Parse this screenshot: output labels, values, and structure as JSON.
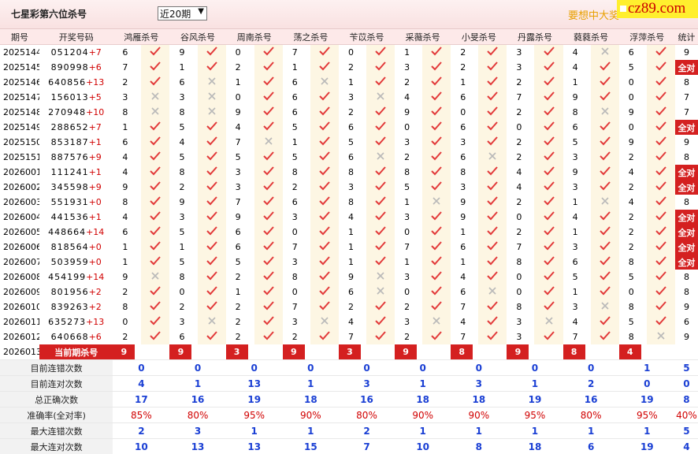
{
  "header": {
    "title": "七星彩第六位杀号",
    "select_value": "近20期",
    "promo": "要想中大奖",
    "logo": "cz89.com"
  },
  "columns": [
    "期号",
    "开奖号码",
    "鸿雁杀号",
    "谷风杀号",
    "周南杀号",
    "荡之杀号",
    "苄苡杀号",
    "采薇杀号",
    "小旻杀号",
    "丹露杀号",
    "蕤蕤杀号",
    "浮萍杀号",
    "统计"
  ],
  "rows": [
    {
      "issue": "2025144",
      "num": "051204",
      "last": "+7",
      "vals": [
        6,
        9,
        0,
        7,
        0,
        1,
        2,
        3,
        4,
        6
      ],
      "ok": [
        1,
        1,
        1,
        1,
        1,
        1,
        1,
        1,
        0,
        1
      ],
      "stat": "9"
    },
    {
      "issue": "2025145",
      "num": "890998",
      "last": "+6",
      "vals": [
        7,
        1,
        2,
        1,
        2,
        3,
        2,
        3,
        4,
        5
      ],
      "ok": [
        1,
        1,
        1,
        1,
        1,
        1,
        1,
        1,
        1,
        1
      ],
      "stat": "全对"
    },
    {
      "issue": "2025146",
      "num": "640856",
      "last": "+13",
      "vals": [
        2,
        6,
        1,
        6,
        1,
        2,
        1,
        2,
        1,
        0
      ],
      "ok": [
        1,
        0,
        1,
        0,
        1,
        1,
        1,
        1,
        1,
        1
      ],
      "stat": "8"
    },
    {
      "issue": "2025147",
      "num": "156013",
      "last": "+5",
      "vals": [
        3,
        3,
        0,
        6,
        3,
        4,
        6,
        7,
        9,
        0
      ],
      "ok": [
        0,
        0,
        1,
        1,
        0,
        1,
        1,
        1,
        1,
        1
      ],
      "stat": "7"
    },
    {
      "issue": "2025148",
      "num": "270948",
      "last": "+10",
      "vals": [
        8,
        8,
        9,
        6,
        2,
        9,
        0,
        2,
        8,
        9
      ],
      "ok": [
        0,
        0,
        1,
        1,
        1,
        1,
        1,
        1,
        0,
        1
      ],
      "stat": "7"
    },
    {
      "issue": "2025149",
      "num": "288652",
      "last": "+7",
      "vals": [
        1,
        5,
        4,
        5,
        6,
        0,
        6,
        0,
        6,
        0
      ],
      "ok": [
        1,
        1,
        1,
        1,
        1,
        1,
        1,
        1,
        1,
        1
      ],
      "stat": "全对"
    },
    {
      "issue": "2025150",
      "num": "853187",
      "last": "+1",
      "vals": [
        6,
        4,
        7,
        1,
        5,
        3,
        3,
        2,
        5,
        9
      ],
      "ok": [
        1,
        1,
        0,
        1,
        1,
        1,
        1,
        1,
        1,
        1
      ],
      "stat": "9"
    },
    {
      "issue": "2025151",
      "num": "887576",
      "last": "+9",
      "vals": [
        4,
        5,
        5,
        5,
        6,
        2,
        6,
        2,
        3,
        2
      ],
      "ok": [
        1,
        1,
        1,
        1,
        0,
        1,
        0,
        1,
        1,
        1
      ],
      "stat": "8"
    },
    {
      "issue": "2026001",
      "num": "111241",
      "last": "+1",
      "vals": [
        4,
        8,
        3,
        8,
        8,
        8,
        8,
        4,
        9,
        4
      ],
      "ok": [
        1,
        1,
        1,
        1,
        1,
        1,
        1,
        1,
        1,
        1
      ],
      "stat": "全对"
    },
    {
      "issue": "2026002",
      "num": "345598",
      "last": "+9",
      "vals": [
        9,
        2,
        3,
        2,
        3,
        5,
        3,
        4,
        3,
        2
      ],
      "ok": [
        1,
        1,
        1,
        1,
        1,
        1,
        1,
        1,
        1,
        1
      ],
      "stat": "全对"
    },
    {
      "issue": "2026003",
      "num": "551931",
      "last": "+0",
      "vals": [
        8,
        9,
        7,
        6,
        8,
        1,
        9,
        2,
        1,
        4
      ],
      "ok": [
        1,
        1,
        1,
        1,
        1,
        0,
        1,
        1,
        0,
        1
      ],
      "stat": "8"
    },
    {
      "issue": "2026004",
      "num": "441536",
      "last": "+1",
      "vals": [
        4,
        3,
        9,
        3,
        4,
        3,
        9,
        0,
        4,
        2
      ],
      "ok": [
        1,
        1,
        1,
        1,
        1,
        1,
        1,
        1,
        1,
        1
      ],
      "stat": "全对"
    },
    {
      "issue": "2026005",
      "num": "448664",
      "last": "+14",
      "vals": [
        6,
        5,
        6,
        0,
        1,
        0,
        1,
        2,
        1,
        2
      ],
      "ok": [
        1,
        1,
        1,
        1,
        1,
        1,
        1,
        1,
        1,
        1
      ],
      "stat": "全对"
    },
    {
      "issue": "2026006",
      "num": "818564",
      "last": "+0",
      "vals": [
        1,
        1,
        6,
        7,
        1,
        7,
        6,
        7,
        3,
        2
      ],
      "ok": [
        1,
        1,
        1,
        1,
        1,
        1,
        1,
        1,
        1,
        1
      ],
      "stat": "全对"
    },
    {
      "issue": "2026007",
      "num": "503959",
      "last": "+0",
      "vals": [
        1,
        5,
        5,
        3,
        1,
        1,
        1,
        8,
        6,
        8
      ],
      "ok": [
        1,
        1,
        1,
        1,
        1,
        1,
        1,
        1,
        1,
        1
      ],
      "stat": "全对"
    },
    {
      "issue": "2026008",
      "num": "454199",
      "last": "+14",
      "vals": [
        9,
        8,
        2,
        8,
        9,
        3,
        4,
        0,
        5,
        5
      ],
      "ok": [
        0,
        1,
        1,
        1,
        0,
        1,
        1,
        1,
        1,
        1
      ],
      "stat": "8"
    },
    {
      "issue": "2026009",
      "num": "801956",
      "last": "+2",
      "vals": [
        2,
        0,
        1,
        0,
        6,
        0,
        6,
        0,
        1,
        0
      ],
      "ok": [
        1,
        1,
        1,
        1,
        0,
        1,
        0,
        1,
        1,
        1
      ],
      "stat": "8"
    },
    {
      "issue": "2026010",
      "num": "839263",
      "last": "+2",
      "vals": [
        8,
        2,
        2,
        7,
        2,
        2,
        7,
        8,
        3,
        8
      ],
      "ok": [
        1,
        1,
        1,
        1,
        1,
        1,
        1,
        1,
        0,
        1
      ],
      "stat": "9"
    },
    {
      "issue": "2026011",
      "num": "635273",
      "last": "+13",
      "vals": [
        0,
        3,
        2,
        3,
        4,
        3,
        4,
        3,
        4,
        5
      ],
      "ok": [
        1,
        0,
        1,
        0,
        1,
        0,
        1,
        0,
        1,
        1
      ],
      "stat": "6"
    },
    {
      "issue": "2026012",
      "num": "640668",
      "last": "+6",
      "vals": [
        2,
        6,
        2,
        2,
        7,
        2,
        7,
        3,
        7,
        8
      ],
      "ok": [
        1,
        1,
        1,
        1,
        1,
        1,
        1,
        1,
        1,
        0
      ],
      "stat": "9"
    }
  ],
  "current": {
    "issue": "2026013",
    "label": "当前期杀号",
    "vals": [
      "9",
      "9",
      "3",
      "9",
      "3",
      "9",
      "8",
      "9",
      "8",
      "4"
    ]
  },
  "summary": [
    {
      "label": "目前连错次数",
      "vals": [
        "0",
        "0",
        "0",
        "0",
        "0",
        "0",
        "0",
        "0",
        "0",
        "1",
        "5"
      ]
    },
    {
      "label": "目前连对次数",
      "vals": [
        "4",
        "1",
        "13",
        "1",
        "3",
        "1",
        "3",
        "1",
        "2",
        "0",
        "0"
      ]
    },
    {
      "label": "总正确次数",
      "vals": [
        "17",
        "16",
        "19",
        "18",
        "16",
        "18",
        "18",
        "19",
        "16",
        "19",
        "8"
      ]
    },
    {
      "label": "准确率(全对率)",
      "vals": [
        "85%",
        "80%",
        "95%",
        "90%",
        "80%",
        "90%",
        "90%",
        "95%",
        "80%",
        "95%",
        "40%"
      ],
      "red": true
    },
    {
      "label": "最大连错次数",
      "vals": [
        "2",
        "3",
        "1",
        "1",
        "2",
        "1",
        "1",
        "1",
        "1",
        "1",
        "5"
      ]
    },
    {
      "label": "最大连对次数",
      "vals": [
        "10",
        "13",
        "13",
        "15",
        "7",
        "10",
        "8",
        "18",
        "6",
        "19",
        "4"
      ]
    }
  ]
}
